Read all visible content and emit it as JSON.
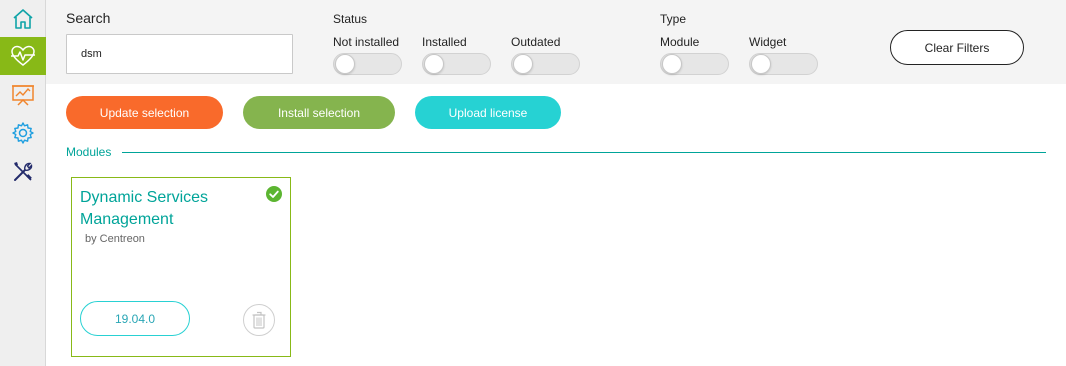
{
  "sidebar": {
    "items": [
      {
        "name": "home",
        "icon": "home-icon",
        "color": "#0fa4a8"
      },
      {
        "name": "monitoring",
        "icon": "heartbeat-icon",
        "color": "#ffffff",
        "active": true
      },
      {
        "name": "reporting",
        "icon": "chart-board-icon",
        "color": "#f0852d"
      },
      {
        "name": "configuration",
        "icon": "gear-icon",
        "color": "#1f9fe0"
      },
      {
        "name": "administration",
        "icon": "tools-icon",
        "color": "#232b6b"
      }
    ]
  },
  "filters": {
    "search_label": "Search",
    "search_value": "dsm",
    "status_label": "Status",
    "status_options": [
      "Not installed",
      "Installed",
      "Outdated"
    ],
    "type_label": "Type",
    "type_options": [
      "Module",
      "Widget"
    ],
    "clear_label": "Clear Filters"
  },
  "actions": {
    "update_label": "Update selection",
    "install_label": "Install selection",
    "upload_label": "Upload license",
    "update_color": "#f96a2b",
    "install_color": "#85b44e",
    "upload_color": "#26d2d3"
  },
  "modules": {
    "section_title": "Modules",
    "cards": [
      {
        "title": "Dynamic Services Management",
        "author": "by Centreon",
        "version": "19.04.0",
        "installed": true
      }
    ]
  }
}
